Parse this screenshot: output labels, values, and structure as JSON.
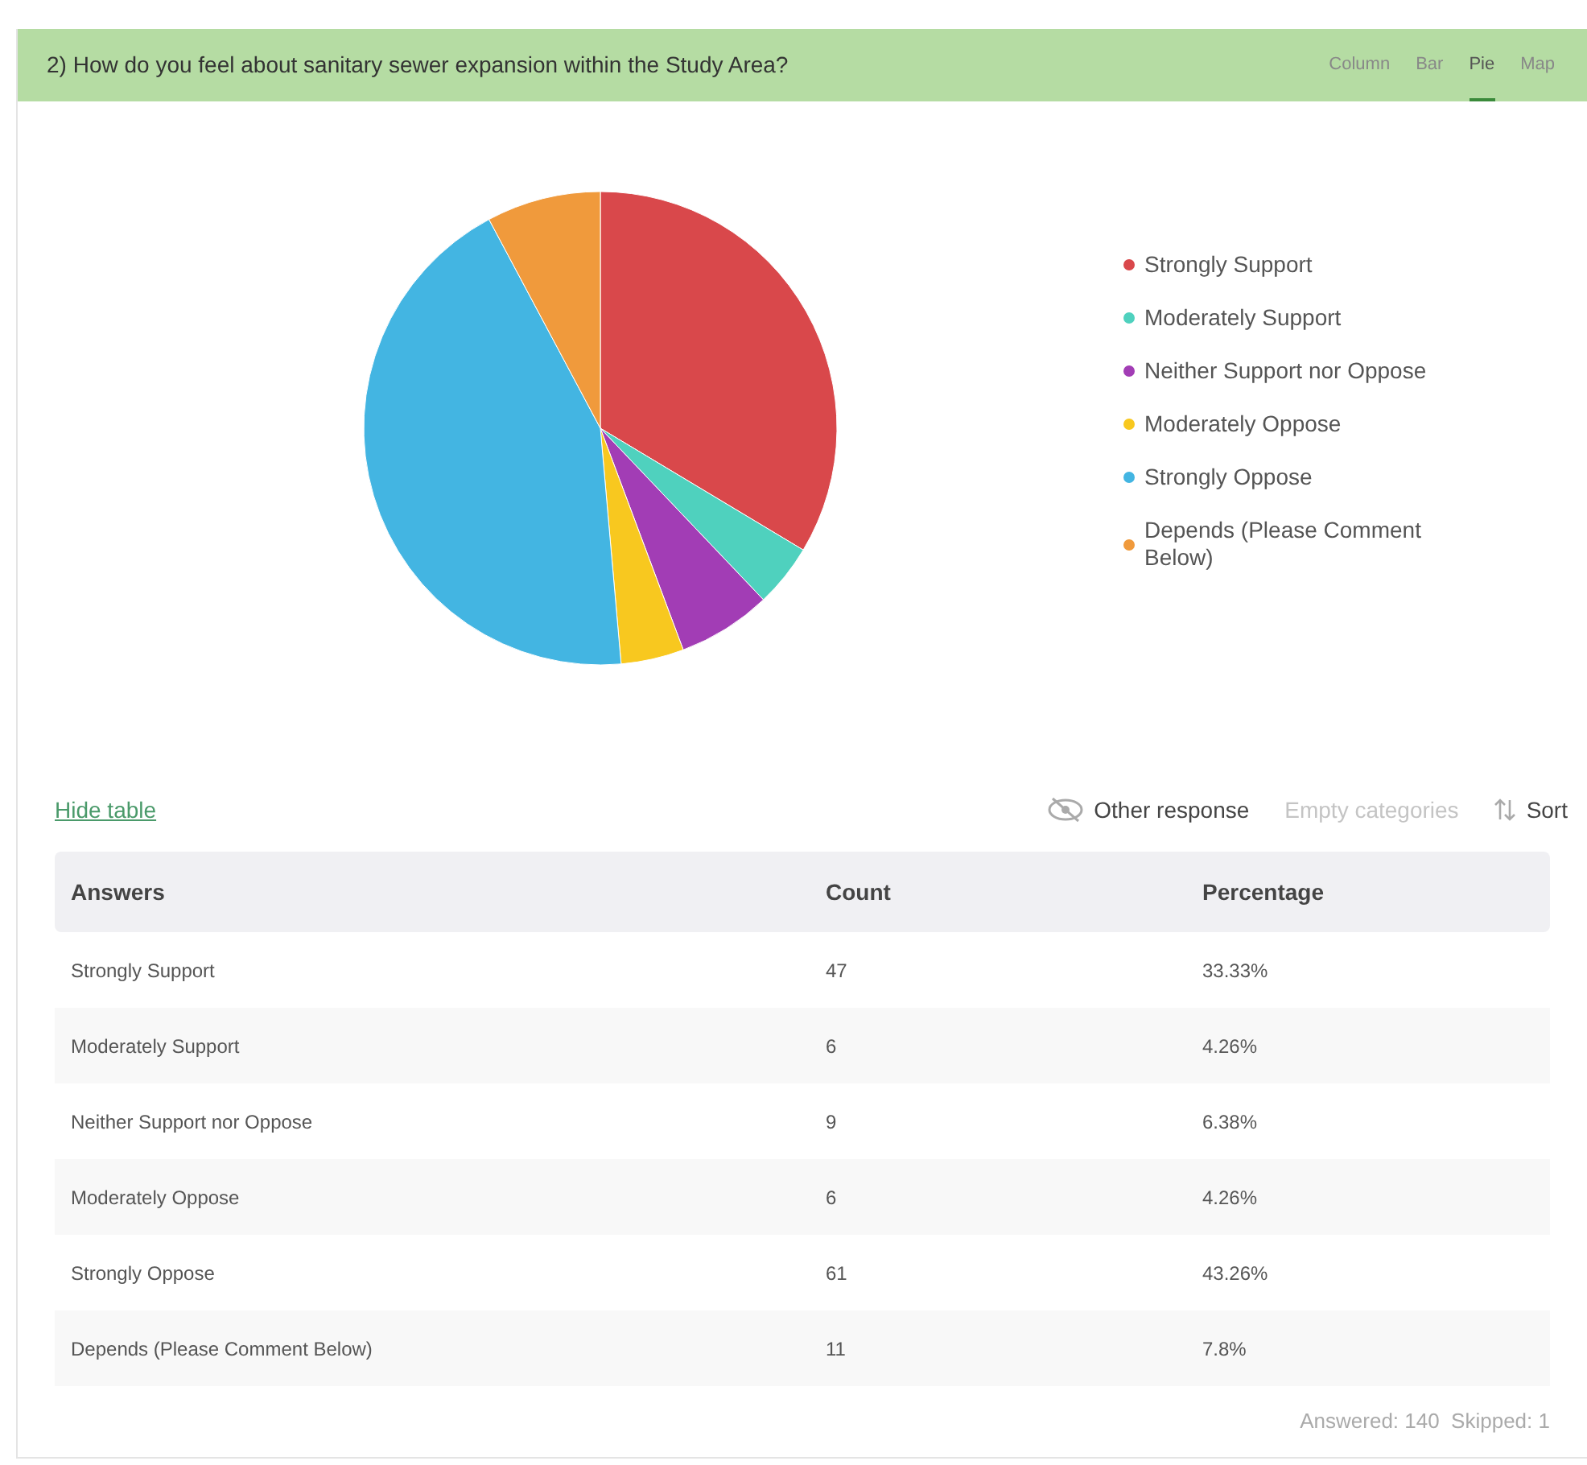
{
  "header": {
    "title": "2) How do you feel about sanitary sewer expansion within the Study Area?",
    "tabs": [
      {
        "label": "Column",
        "selected": false
      },
      {
        "label": "Bar",
        "selected": false
      },
      {
        "label": "Pie",
        "selected": true
      },
      {
        "label": "Map",
        "selected": false
      }
    ]
  },
  "chart": {
    "chart_data": {
      "type": "pie",
      "categories": [
        "Strongly Support",
        "Moderately Support",
        "Neither Support nor Oppose",
        "Moderately Oppose",
        "Strongly Oppose",
        "Depends (Please Comment Below)"
      ],
      "series": [
        {
          "values": [
            33.6,
            4.3,
            6.4,
            4.3,
            43.6,
            7.8
          ]
        }
      ]
    },
    "legend": [
      {
        "color": "#d9484b"
      },
      {
        "color": "#4fd1be"
      },
      {
        "color": "#a23db5"
      },
      {
        "color": "#f8c81f"
      },
      {
        "color": "#43b5e2"
      },
      {
        "color": "#f09a3c"
      }
    ]
  },
  "toolbar": {
    "hide_table": "Hide table",
    "options": [
      {
        "kind": "eye",
        "label": "Other response",
        "disabled": false
      },
      {
        "kind": "plain",
        "label": "Empty categories",
        "disabled": true
      },
      {
        "kind": "sort",
        "label": "Sort",
        "disabled": false
      }
    ]
  },
  "table": {
    "columns": [
      "Answers",
      "Count",
      "Percentage"
    ],
    "rows": [
      [
        "Strongly Support",
        "47",
        "33.33%"
      ],
      [
        "Moderately Support",
        "6",
        "4.26%"
      ],
      [
        "Neither Support nor Oppose",
        "9",
        "6.38%"
      ],
      [
        "Moderately Oppose",
        "6",
        "4.26%"
      ],
      [
        "Strongly Oppose",
        "61",
        "43.26%"
      ],
      [
        "Depends (Please Comment Below)",
        "11",
        "7.8%"
      ]
    ]
  },
  "footer": "Answered: 140  Skipped: 1"
}
